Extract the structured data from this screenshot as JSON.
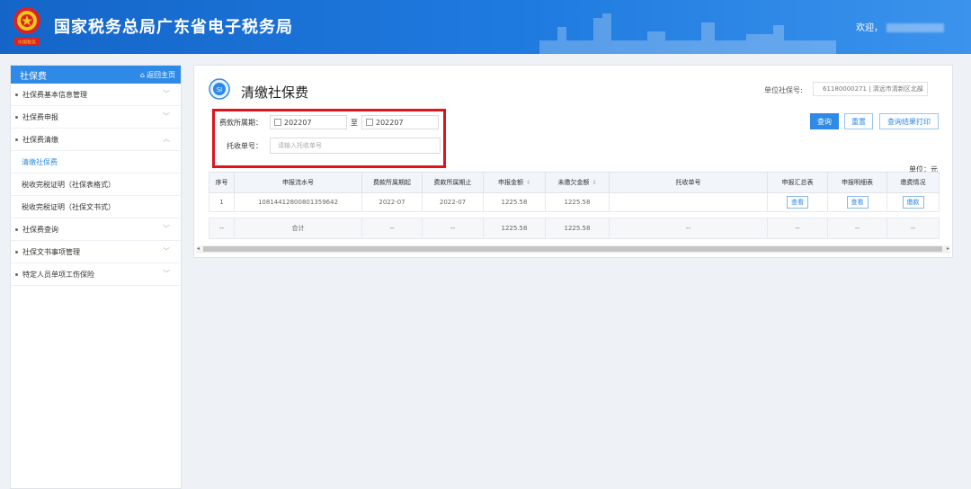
{
  "header": {
    "title": "国家税务总局广东省电子税务局",
    "welcome": "欢迎，",
    "emblem_text": "中国税务"
  },
  "sidebar": {
    "title": "社保费",
    "home_link": "返回主页",
    "items": [
      {
        "label": "社保费基本信息管理",
        "type": "group",
        "expanded": false
      },
      {
        "label": "社保费申报",
        "type": "group",
        "expanded": false
      },
      {
        "label": "社保费清缴",
        "type": "group",
        "expanded": true
      },
      {
        "label": "清缴社保费",
        "type": "sub",
        "active": true
      },
      {
        "label": "税收完税证明（社保表格式）",
        "type": "sub"
      },
      {
        "label": "税收完税证明（社保文书式）",
        "type": "sub"
      },
      {
        "label": "社保费查询",
        "type": "group",
        "expanded": false
      },
      {
        "label": "社保文书事项管理",
        "type": "group",
        "expanded": false
      },
      {
        "label": "特定人员单项工伤保险",
        "type": "group",
        "expanded": false
      }
    ]
  },
  "main": {
    "title": "清缴社保费",
    "unit_label": "单位社保号:",
    "unit_value": "61180000271 | 清远市清新区北部",
    "form": {
      "period_label": "费款所属期：",
      "period_start": "202207",
      "period_to": "至",
      "period_end": "202207",
      "ticket_label": "托收单号：",
      "ticket_placeholder": "请输入托收单号"
    },
    "buttons": {
      "query": "查询",
      "reset": "重置",
      "print": "查询结果打印"
    },
    "currency_unit": "单位：元",
    "table": {
      "headers": [
        "序号",
        "申报流水号",
        "费款所属期起",
        "费款所属期止",
        "申报金额",
        "未缴欠金额",
        "托收单号",
        "申报汇总表",
        "申报明细表",
        "缴费情况"
      ],
      "rows": [
        {
          "seq": "1",
          "serial": "10814412800801359642",
          "start": "2022-07",
          "end": "2022-07",
          "declared": "1225.58",
          "unpaid": "1225.58",
          "ticket": "",
          "summary": "查看",
          "detail": "查看",
          "status": "缴款"
        }
      ],
      "total": {
        "seq": "--",
        "label": "合计",
        "start": "--",
        "end": "--",
        "declared": "1225.58",
        "unpaid": "1225.58",
        "ticket": "--",
        "summary": "--",
        "detail": "--",
        "status": "--"
      }
    }
  },
  "colors": {
    "header_blue": "#1f7be0",
    "accent": "#2e8ae6",
    "highlight_red": "#e0141c"
  }
}
